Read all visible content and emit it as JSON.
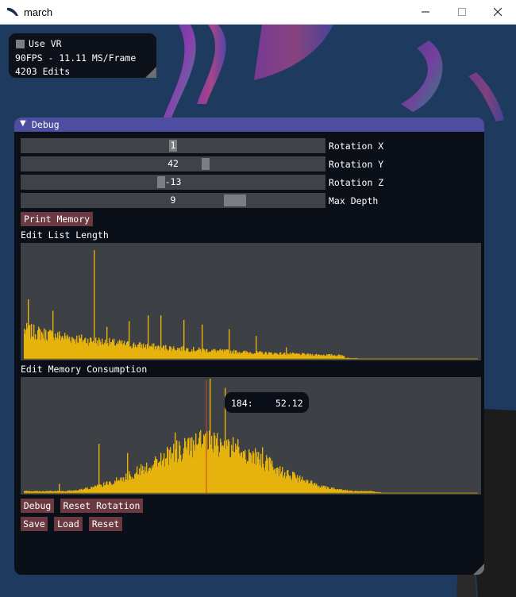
{
  "window": {
    "title": "march",
    "app_icon": "feather-icon",
    "controls": {
      "minimize": "—",
      "maximize": "☐",
      "close": "✕"
    }
  },
  "overlay": {
    "vr_label": "Use VR",
    "vr_checked": false,
    "fps_text": "90FPS - 11.11 MS/Frame",
    "edits_text": "4203 Edits"
  },
  "debug": {
    "title": "Debug",
    "collapse_icon": "▼",
    "sliders": [
      {
        "label": "Rotation X",
        "value": "1",
        "fraction": 0.5
      },
      {
        "label": "Rotation Y",
        "value": "42",
        "fraction": 0.61
      },
      {
        "label": "Rotation Z",
        "value": "-13",
        "fraction": 0.46
      },
      {
        "label": "Max Depth",
        "value": "9",
        "fraction": 0.72
      }
    ],
    "print_memory_label": "Print Memory",
    "edit_list_label": "Edit List Length",
    "edit_memory_label": "Edit Memory Consumption",
    "tooltip_index": "184:",
    "tooltip_value": "52.12",
    "buttons_row1": [
      "Debug",
      "Reset Rotation"
    ],
    "buttons_row2": [
      "Save",
      "Load",
      "Reset"
    ]
  },
  "colors": {
    "plot_bar": "#e6b30c",
    "plot_bg": "#3d4145",
    "title_bar": "#4e4ea0",
    "button": "#6a3a40",
    "panel": "#0b0f17"
  }
}
